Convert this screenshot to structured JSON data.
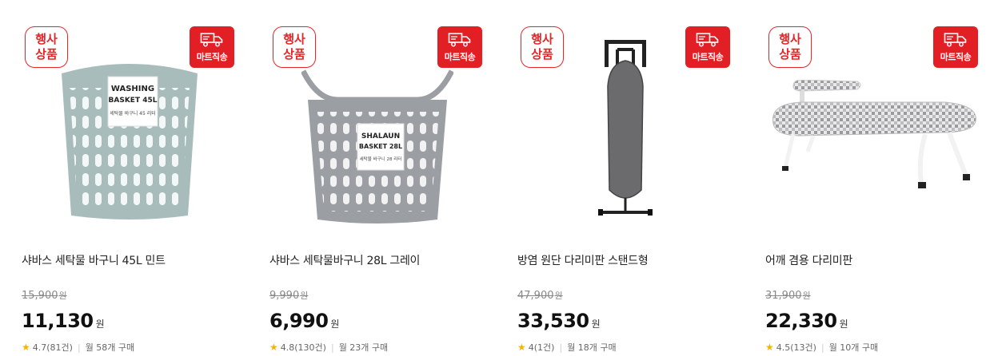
{
  "colors": {
    "accent_red": "#e31f26",
    "star": "#f5b400"
  },
  "badges": {
    "event": "행사\n상품",
    "delivery": "마트직송",
    "delivery_icon": "truck-icon"
  },
  "products": [
    {
      "name": "샤바스 세탁물 바구니 45L 민트",
      "original_price": "15,900",
      "price": "11,130",
      "currency": "원",
      "rating": "4.7(81건)",
      "monthly_purchases": "월 58개 구매",
      "image_label_1": "WASHING",
      "image_label_2": "BASKET 45L",
      "image_label_3": "세탁물 바구니 45 리터"
    },
    {
      "name": "샤바스 세탁물바구니 28L 그레이",
      "original_price": "9,990",
      "price": "6,990",
      "currency": "원",
      "rating": "4.8(130건)",
      "monthly_purchases": "월 23개 구매",
      "image_label_1": "SHALAUN",
      "image_label_2": "BASKET 28L",
      "image_label_3": "세탁물 바구니 28 리터"
    },
    {
      "name": "방염 원단 다리미판 스탠드형",
      "original_price": "47,900",
      "price": "33,530",
      "currency": "원",
      "rating": "4(1건)",
      "monthly_purchases": "월 18개 구매"
    },
    {
      "name": "어깨 겸용 다리미판",
      "original_price": "31,900",
      "price": "22,330",
      "currency": "원",
      "rating": "4.5(13건)",
      "monthly_purchases": "월 10개 구매"
    }
  ]
}
